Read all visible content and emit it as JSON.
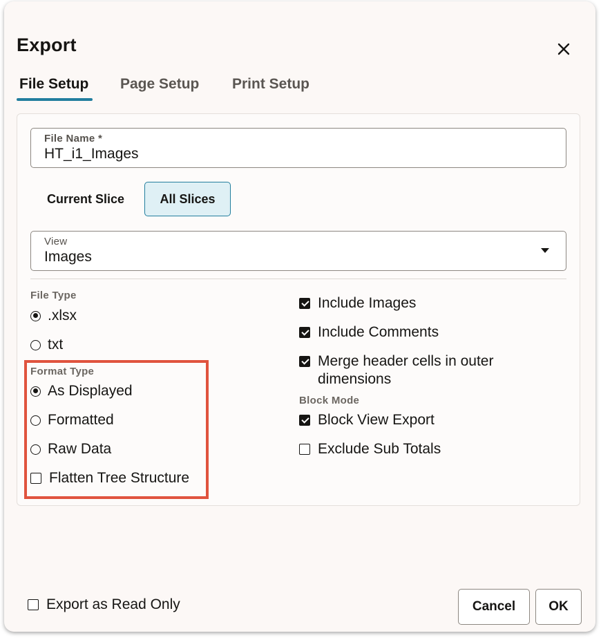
{
  "dialog": {
    "title": "Export",
    "close_icon": "close-icon"
  },
  "tabs": [
    {
      "label": "File Setup",
      "active": true
    },
    {
      "label": "Page Setup",
      "active": false
    },
    {
      "label": "Print Setup",
      "active": false
    }
  ],
  "file_name": {
    "label": "File Name *",
    "value": "HT_i1_Images"
  },
  "slices": {
    "current_label": "Current Slice",
    "all_label": "All Slices",
    "selected": "All Slices"
  },
  "view": {
    "label": "View",
    "value": "Images",
    "icon": "chevron-down-icon"
  },
  "file_type": {
    "label": "File Type",
    "options": [
      {
        "label": ".xlsx",
        "selected": true
      },
      {
        "label": "txt",
        "selected": false
      }
    ]
  },
  "format_type": {
    "label": "Format Type",
    "options": [
      {
        "label": "As Displayed",
        "selected": true
      },
      {
        "label": "Formatted",
        "selected": false
      },
      {
        "label": "Raw Data",
        "selected": false
      }
    ],
    "flatten_label": "Flatten Tree Structure",
    "flatten_checked": false
  },
  "include": {
    "images_label": "Include Images",
    "images_checked": true,
    "comments_label": "Include Comments",
    "comments_checked": true,
    "merge_label": "Merge header cells in outer dimensions",
    "merge_checked": true
  },
  "block_mode": {
    "label": "Block Mode",
    "block_view_label": "Block View Export",
    "block_view_checked": true,
    "exclude_sub_totals_label": "Exclude Sub Totals",
    "exclude_sub_totals_checked": false
  },
  "footer": {
    "read_only_label": "Export as Read Only",
    "read_only_checked": false,
    "cancel_label": "Cancel",
    "ok_label": "OK"
  },
  "colors": {
    "accent": "#227e9e",
    "highlight": "#e0533e",
    "dialog_bg": "#fcf8f6"
  }
}
